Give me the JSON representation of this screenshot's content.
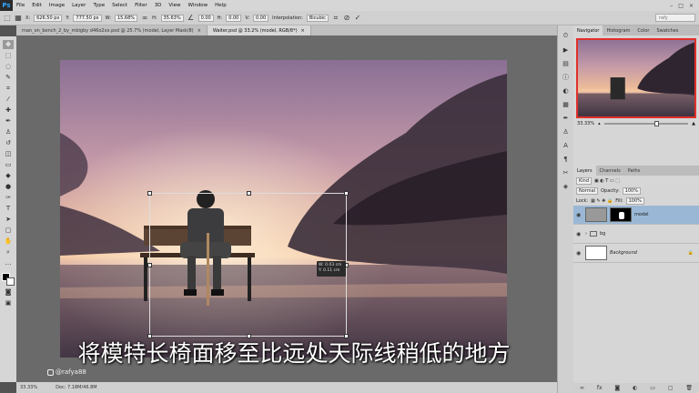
{
  "app": {
    "logo": "Ps"
  },
  "menu": [
    "File",
    "Edit",
    "Image",
    "Layer",
    "Type",
    "Select",
    "Filter",
    "3D",
    "View",
    "Window",
    "Help"
  ],
  "options": {
    "x_label": "X:",
    "x_value": "626.50 px",
    "y_label": "Y:",
    "y_value": "777.50 px",
    "w_label": "W:",
    "w_value": "15.68%",
    "h_label": "H:",
    "h_value": "35.63%",
    "angle_value": "0.00",
    "hskew_label": "H:",
    "hskew_value": "0.00",
    "vskew_label": "V:",
    "vskew_value": "0.00",
    "interp_label": "Interpolation:",
    "interp_value": "Bicubic",
    "search_placeholder": "rafy"
  },
  "tabs": [
    {
      "label": "man_on_bench_2_by_mbigby d46o2xx.psd @ 25.7% (model, Layer Mask/8)",
      "close": "×"
    },
    {
      "label": "Waiter.psd @ 33.2% (model, RGB/8*)",
      "close": "×"
    }
  ],
  "canvas": {
    "dim_tip_w": "W: 0.03 cm",
    "dim_tip_h": "Y: 0.11 cm",
    "caption": "将模特长椅面移至比远处天际线稍低的地方",
    "watermark": "@rafya88"
  },
  "status": {
    "zoom": "33.33%",
    "doc": "Doc: 7.18M/46.8M"
  },
  "panels": {
    "top_tabs": [
      "Navigator",
      "Histogram",
      "Color",
      "Swatches"
    ],
    "nav_zoom": "33.33%",
    "layer_tabs": [
      "Layers",
      "Channels",
      "Paths"
    ],
    "kind_label": "Kind",
    "blend_mode": "Normal",
    "opacity_label": "Opacity:",
    "opacity_value": "100%",
    "lock_label": "Lock:",
    "fill_label": "Fill:",
    "fill_value": "100%",
    "layers": [
      {
        "name": "model",
        "active": true
      },
      {
        "name": "bg",
        "active": false
      },
      {
        "name": "Background",
        "active": false
      }
    ]
  },
  "colors": {
    "accent": "#e0302a",
    "ps_blue": "#31a8ff",
    "panel_bg": "#d6d6d6"
  }
}
